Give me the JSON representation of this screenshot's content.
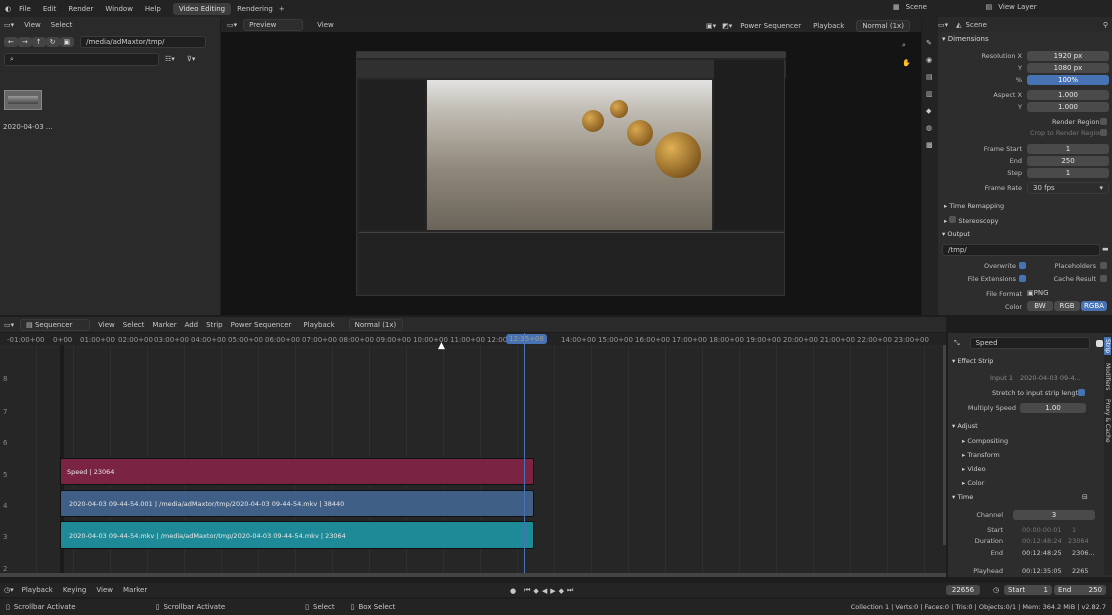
{
  "topbar": {
    "menus": [
      "File",
      "Edit",
      "Render",
      "Window",
      "Help"
    ],
    "tabs": [
      "Video Editing",
      "Rendering"
    ],
    "add": "+",
    "scene": "Scene",
    "view_layer": "View Layer"
  },
  "filebrowser": {
    "menus": [
      "View",
      "Select"
    ],
    "path": "/media/adMaxtor/tmp/",
    "thumb_label": "2020-04-03 ..."
  },
  "preview": {
    "mode": "Preview",
    "view": "View",
    "right": [
      "Power Sequencer",
      "Playback",
      "Normal (1x)"
    ]
  },
  "props": {
    "scene": "Scene",
    "dimensions": "Dimensions",
    "res_x_label": "Resolution X",
    "res_x": "1920 px",
    "res_y_label": "Y",
    "res_y": "1080 px",
    "pct_label": "%",
    "pct": "100%",
    "aspect_x_label": "Aspect X",
    "aspect_x": "1.000",
    "aspect_y_label": "Y",
    "aspect_y": "1.000",
    "render_region": "Render Region",
    "crop": "Crop to Render Region",
    "frame_start_label": "Frame Start",
    "frame_start": "1",
    "end_label": "End",
    "end": "250",
    "step_label": "Step",
    "step": "1",
    "frame_rate_label": "Frame Rate",
    "frame_rate": "30 fps",
    "time_remap": "Time Remapping",
    "stereo": "Stereoscopy",
    "output": "Output",
    "out_path": "/tmp/",
    "overwrite": "Overwrite",
    "placeholders": "Placeholders",
    "file_ext": "File Extensions",
    "cache_result": "Cache Result",
    "file_format_label": "File Format",
    "file_format": "PNG",
    "color_label": "Color",
    "color_opts": [
      "BW",
      "RGB",
      "RGBA"
    ]
  },
  "sequencer": {
    "header": [
      "Sequencer",
      "View",
      "Select",
      "Marker",
      "Add",
      "Strip",
      "Power Sequencer",
      "Playback",
      "Normal (1x)"
    ],
    "ticks": [
      "-01:00+00",
      "0+00",
      "01:00+00",
      "02:00+00",
      "03:00+00",
      "04:00+00",
      "05:00+00",
      "06:00+00",
      "07:00+00",
      "08:00+00",
      "09:00+00",
      "10:00+00",
      "11:00+00",
      "12:00",
      "12:35+08",
      "14:00+00",
      "15:00+00",
      "16:00+00",
      "17:00+00",
      "18:00+00",
      "19:00+00",
      "20:00+00",
      "21:00+00",
      "22:00+00",
      "23:00+00"
    ],
    "channels": [
      "2",
      "3",
      "4",
      "5",
      "6",
      "7",
      "8"
    ],
    "strips": [
      {
        "label": "Speed | 23064",
        "color": "#7b2342"
      },
      {
        "label": "2020-04-03 09-44-54.001 | /media/adMaxtor/tmp/2020-04-03 09-44-54.mkv | 38440",
        "color": "#3f5f86"
      },
      {
        "label": "2020-04-03 09-44-54.mkv | /media/adMaxtor/tmp/2020-04-03 09-44-54.mkv | 23064",
        "color": "#1f8a97"
      }
    ]
  },
  "strip_panel": {
    "name": "Speed",
    "effect_strip": "Effect Strip",
    "input1_label": "Input 1",
    "input1": "2020-04-03 09-4...",
    "stretch": "Stretch to input strip length",
    "mult_label": "Multiply Speed",
    "mult": "1.00",
    "adjust": "Adjust",
    "adj_items": [
      "Compositing",
      "Transform",
      "Video",
      "Color"
    ],
    "time": "Time",
    "channel_label": "Channel",
    "channel": "3",
    "start_label": "Start",
    "start_a": "00:00:00:01",
    "start_b": "1",
    "duration_label": "Duration",
    "duration_a": "00:12:48:24",
    "duration_b": "23064",
    "end_label": "End",
    "end_a": "00:12:48:25",
    "end_b": "2306...",
    "playhead_label": "Playhead",
    "playhead_a": "00:12:35:05",
    "playhead_b": "2265",
    "tabs": [
      "Strip",
      "Modifiers",
      "Proxy & Cache"
    ]
  },
  "timeline": {
    "menus": [
      "Playback",
      "Keying",
      "View",
      "Marker"
    ],
    "current": "22656",
    "start_label": "Start",
    "start": "1",
    "end_label": "End",
    "end": "250"
  },
  "status": {
    "left": [
      "Scrollbar Activate",
      "Scrollbar Activate",
      "Select",
      "Box Select"
    ],
    "right": "Collection 1 | Verts:0 | Faces:0 | Tris:0 | Objects:0/1 | Mem: 364.2 MiB | v2.82.7"
  },
  "colors": {
    "accent": "#4772b3",
    "playhead": "#4772b3"
  }
}
